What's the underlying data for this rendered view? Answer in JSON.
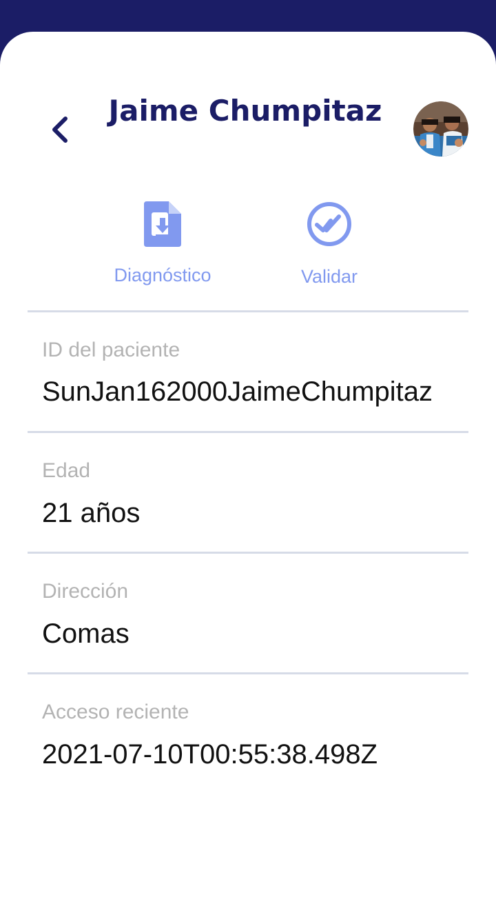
{
  "header": {
    "title": "Jaime Chumpitaz"
  },
  "icons": {
    "back": "chevron-left-icon",
    "avatar": "profile-photo",
    "diagnostico": "file-download-icon",
    "validar": "check-circle-icon"
  },
  "actions": {
    "diagnostico_label": "Diagnóstico",
    "validar_label": "Validar"
  },
  "fields": [
    {
      "label": "ID del paciente",
      "value": "SunJan162000JaimeChumpitaz"
    },
    {
      "label": "Edad",
      "value": "21 años"
    },
    {
      "label": "Dirección",
      "value": "Comas"
    },
    {
      "label": "Acceso reciente",
      "value": "2021-07-10T00:55:38.498Z"
    }
  ],
  "colors": {
    "header_bg": "#1b1d66",
    "title": "#1b1d66",
    "accent": "#8199ef",
    "divider": "#d6dbe7",
    "label": "#b3b3b3"
  }
}
